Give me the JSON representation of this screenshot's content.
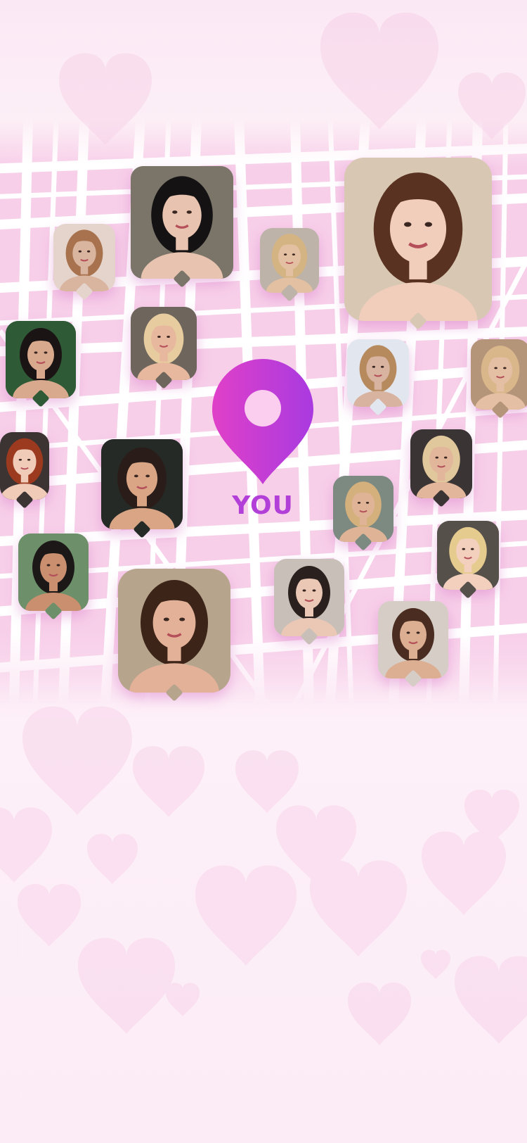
{
  "screen": {
    "user_marker_label": "YOU",
    "user_marker_icon": "location-pin-icon",
    "accent_gradient": [
      "#e040c8",
      "#a93ae0"
    ],
    "label_color": "#b23fd8",
    "background_color": "#fbe3f2",
    "map_street_color": "#ffffff",
    "map_block_color": "#f8d3ec"
  },
  "nearby_profiles": [
    {
      "name": "profile-photo-1",
      "tone": "#d9b49f",
      "hair": "#a9724e",
      "bg": "#e4d4cc"
    },
    {
      "name": "profile-photo-2",
      "tone": "#e8c3b0",
      "hair": "#151214",
      "bg": "#7a7568"
    },
    {
      "name": "profile-photo-3",
      "tone": "#e3c0a2",
      "hair": "#d4b483",
      "bg": "#bdb3a8"
    },
    {
      "name": "profile-photo-4",
      "tone": "#f1cdbc",
      "hair": "#5a3222",
      "bg": "#d8c8b3"
    },
    {
      "name": "profile-photo-5",
      "tone": "#d9a98e",
      "hair": "#1b1414",
      "bg": "#2f5a36"
    },
    {
      "name": "profile-photo-6",
      "tone": "#e7b89d",
      "hair": "#e7cc9f",
      "bg": "#6e665c"
    },
    {
      "name": "profile-photo-7",
      "tone": "#d7b3a0",
      "hair": "#b68a5d",
      "bg": "#e2e6ee"
    },
    {
      "name": "profile-photo-8",
      "tone": "#e5bfa3",
      "hair": "#d9b78a",
      "bg": "#b4957a"
    },
    {
      "name": "profile-photo-9",
      "tone": "#f0cbb8",
      "hair": "#9b3a1f",
      "bg": "#3b3432"
    },
    {
      "name": "profile-photo-10",
      "tone": "#d9a585",
      "hair": "#2a1c18",
      "bg": "#252a27"
    },
    {
      "name": "profile-photo-11",
      "tone": "#dfb396",
      "hair": "#d3b07c",
      "bg": "#7d8a82"
    },
    {
      "name": "profile-photo-12",
      "tone": "#e2b69b",
      "hair": "#e0c89c",
      "bg": "#3a3434"
    },
    {
      "name": "profile-photo-13",
      "tone": "#c98f6f",
      "hair": "#1d1818",
      "bg": "#6d8f6a"
    },
    {
      "name": "profile-photo-14",
      "tone": "#e3b198",
      "hair": "#3c2518",
      "bg": "#b7a48d"
    },
    {
      "name": "profile-photo-15",
      "tone": "#ebc8b5",
      "hair": "#2a201d",
      "bg": "#c8c0b8"
    },
    {
      "name": "profile-photo-16",
      "tone": "#f2d0bd",
      "hair": "#e5cb8e",
      "bg": "#56504a"
    },
    {
      "name": "profile-photo-17",
      "tone": "#dcae92",
      "hair": "#4a2d20",
      "bg": "#d6cdc6"
    }
  ]
}
